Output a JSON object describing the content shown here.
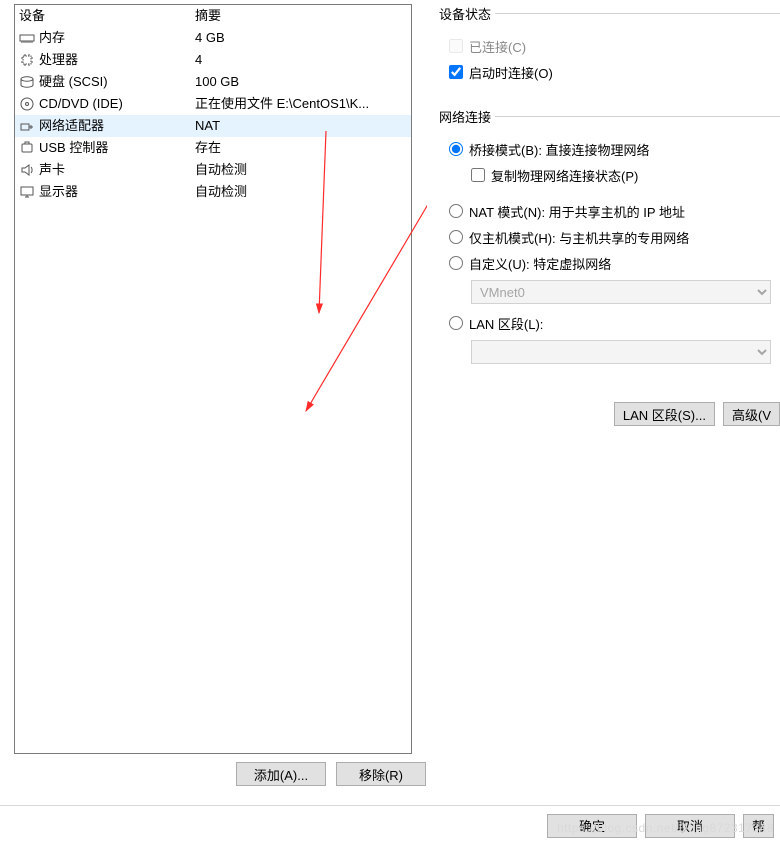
{
  "headers": {
    "device": "设备",
    "summary": "摘要"
  },
  "rows": [
    {
      "icon": "memory-icon",
      "name": "内存",
      "summary": "4 GB"
    },
    {
      "icon": "cpu-icon",
      "name": "处理器",
      "summary": "4"
    },
    {
      "icon": "disk-icon",
      "name": "硬盘 (SCSI)",
      "summary": "100 GB"
    },
    {
      "icon": "cd-icon",
      "name": "CD/DVD (IDE)",
      "summary": "正在使用文件 E:\\CentOS1\\K..."
    },
    {
      "icon": "nic-icon",
      "name": "网络适配器",
      "summary": "NAT",
      "selected": true
    },
    {
      "icon": "usb-icon",
      "name": "USB 控制器",
      "summary": "存在"
    },
    {
      "icon": "sound-icon",
      "name": "声卡",
      "summary": "自动检测"
    },
    {
      "icon": "display-icon",
      "name": "显示器",
      "summary": "自动检测"
    }
  ],
  "left_buttons": {
    "add": "添加(A)...",
    "remove": "移除(R)"
  },
  "status": {
    "legend": "设备状态",
    "connected": "已连接(C)",
    "connect_at_power_on": "启动时连接(O)"
  },
  "net": {
    "legend": "网络连接",
    "bridged": "桥接模式(B): 直接连接物理网络",
    "replicate": "复制物理网络连接状态(P)",
    "nat": "NAT 模式(N): 用于共享主机的 IP 地址",
    "hostonly": "仅主机模式(H): 与主机共享的专用网络",
    "custom": "自定义(U): 特定虚拟网络",
    "custom_value": "VMnet0",
    "lanseg": "LAN 区段(L):",
    "lanseg_value": "",
    "btn_lan": "LAN 区段(S)...",
    "btn_adv": "高级(V"
  },
  "bottom": {
    "ok": "确定",
    "cancel": "取消",
    "help": "帮"
  },
  "watermark": "https://blog.csdn.net/Dong872317348"
}
